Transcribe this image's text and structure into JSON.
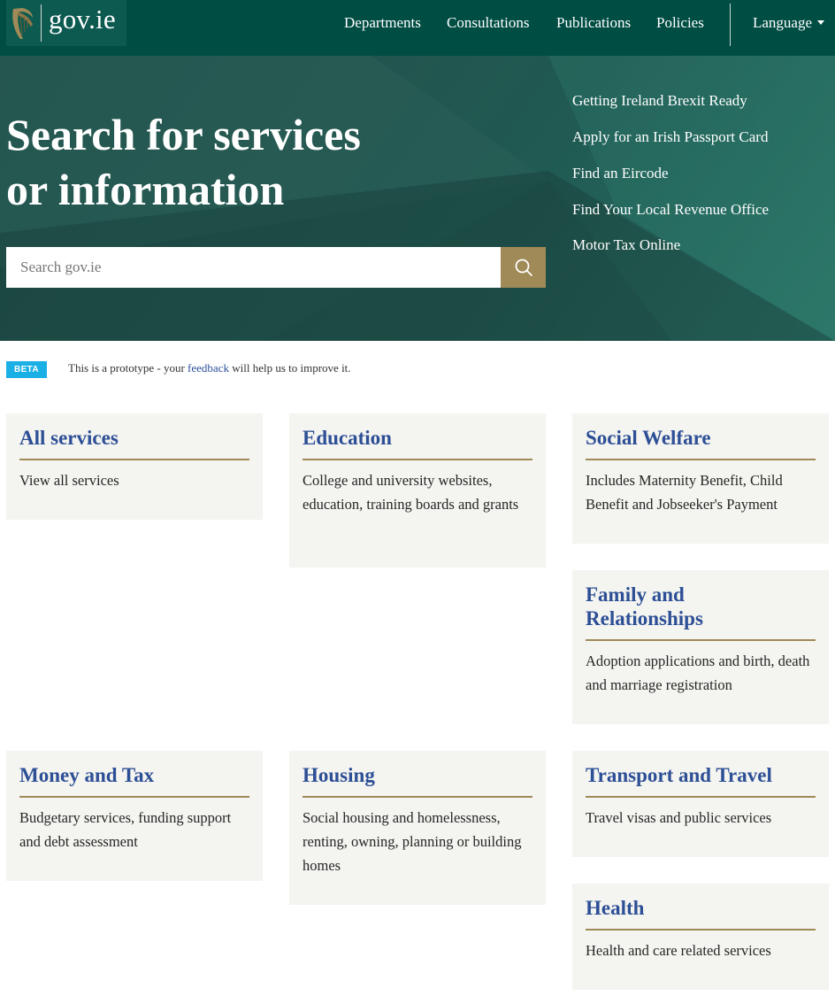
{
  "header": {
    "logo_text": "gov.ie",
    "nav": [
      "Departments",
      "Consultations",
      "Publications",
      "Policies"
    ],
    "language_label": "Language"
  },
  "hero": {
    "title_line1": "Search for services",
    "title_line2": "or information",
    "search_placeholder": "Search gov.ie",
    "quick_links": [
      "Getting Ireland Brexit Ready",
      "Apply for an Irish Passport Card",
      "Find an Eircode",
      "Find Your Local Revenue Office",
      "Motor Tax Online"
    ]
  },
  "beta": {
    "badge": "BETA",
    "text_before": "This is a prototype - your ",
    "link": "feedback",
    "text_after": " will help us to improve it."
  },
  "cards": [
    {
      "title": "All services",
      "description": "View all services"
    },
    {
      "title": "Education",
      "description": "College and university websites, education, training boards and grants"
    },
    {
      "title": "Social Welfare",
      "description": "Includes Maternity Benefit, Child Benefit and Jobseeker's Payment"
    },
    {
      "title": "Family and Relationships",
      "description": "Adoption applications and birth, death and marriage registration"
    },
    {
      "title": "Money and Tax",
      "description": "Budgetary services, funding support and debt assessment"
    },
    {
      "title": "Housing",
      "description": "Social housing and homelessness, renting, owning, planning or building homes"
    },
    {
      "title": "Transport and Travel",
      "description": "Travel visas and public services"
    },
    {
      "title": "Health",
      "description": "Health and care related services"
    }
  ],
  "colors": {
    "header_bg": "#004d44",
    "accent_gold": "#a08a58",
    "link_blue": "#2d4f96",
    "beta_blue": "#1ab0e6",
    "card_bg": "#f4f4f0"
  },
  "icons": {
    "logo": "harp-icon",
    "search": "search-icon",
    "language": "caret-down-icon"
  }
}
